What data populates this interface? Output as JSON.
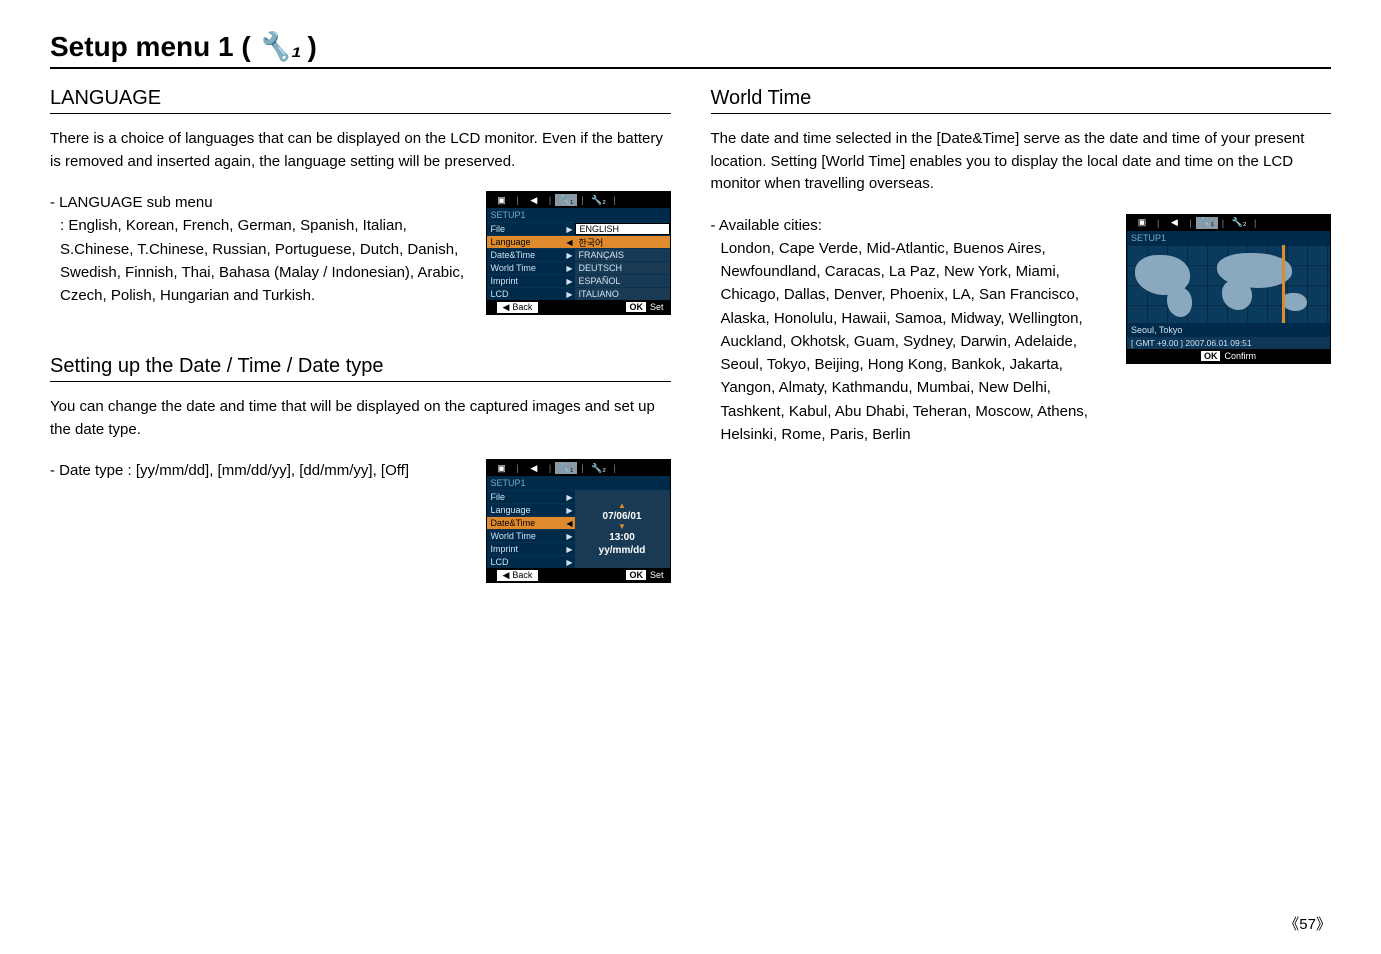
{
  "title_prefix": "Setup menu 1 (",
  "title_suffix": ")",
  "wrench_glyph": "🔧₁",
  "left": {
    "language": {
      "heading": "LANGUAGE",
      "body": "There is a choice of languages that can be displayed on the LCD monitor. Even if the battery is removed and inserted again, the language setting will be preserved.",
      "sub_title": "- LANGUAGE sub menu",
      "sub_body": ": English, Korean, French, German, Spanish, Italian, S.Chinese, T.Chinese, Russian, Portuguese, Dutch, Danish, Swedish, Finnish, Thai, Bahasa (Malay / Indonesian), Arabic, Czech, Polish, Hungarian and Turkish."
    },
    "datetime": {
      "heading": "Setting up the Date / Time / Date type",
      "body": "You can change the date and time that will be displayed on the captured images and set up the date type.",
      "sub_title": "- Date type :",
      "sub_body": "[yy/mm/dd], [mm/dd/yy], [dd/mm/yy], [Off]"
    }
  },
  "right": {
    "world": {
      "heading": "World Time",
      "body": "The date and time selected in the [Date&Time] serve as the date and time of your present location. Setting [World Time] enables you to display the local date and time on the LCD monitor when travelling overseas.",
      "sub_title": "- Available cities:",
      "cities": "London, Cape Verde, Mid-Atlantic, Buenos Aires, Newfoundland, Caracas, La Paz, New York, Miami, Chicago, Dallas, Denver, Phoenix, LA, San Francisco, Alaska, Honolulu, Hawaii, Samoa, Midway, Wellington, Auckland, Okhotsk, Guam, Sydney, Darwin, Adelaide, Seoul, Tokyo, Beijing, Hong Kong, Bankok, Jakarta, Yangon, Almaty, Kathmandu, Mumbai, New Delhi, Tashkent, Kabul, Abu Dhabi, Teheran, Moscow, Athens, Helsinki, Rome, Paris, Berlin"
    }
  },
  "menu_lang": {
    "setup_label": "SETUP1",
    "rows": [
      {
        "label": "File",
        "value": "ENGLISH",
        "sel": true
      },
      {
        "label": "Language",
        "value": "한국어",
        "lsel": true
      },
      {
        "label": "Date&Time",
        "value": "FRANÇAIS"
      },
      {
        "label": "World Time",
        "value": "DEUTSCH"
      },
      {
        "label": "Imprint",
        "value": "ESPAÑOL"
      },
      {
        "label": "LCD",
        "value": "ITALIANO"
      }
    ],
    "back": "Back",
    "ok": "OK",
    "set": "Set"
  },
  "menu_dt": {
    "setup_label": "SETUP1",
    "rows": [
      "File",
      "Language",
      "Date&Time",
      "World Time",
      "Imprint",
      "LCD"
    ],
    "highlighted_index": 2,
    "date": "07/06/01",
    "time": "13:00",
    "format": "yy/mm/dd",
    "back": "Back",
    "ok": "OK",
    "set": "Set"
  },
  "menu_world": {
    "setup_label": "SETUP1",
    "city": "Seoul, Tokyo",
    "gmt": "[ GMT +9.00 ]   2007.06.01   09:51",
    "ok": "OK",
    "confirm": "Confirm"
  },
  "tabs": {
    "camera": "▣",
    "video": "◀",
    "s1": "🔧₁",
    "s2": "🔧₂"
  },
  "page_number": "57"
}
